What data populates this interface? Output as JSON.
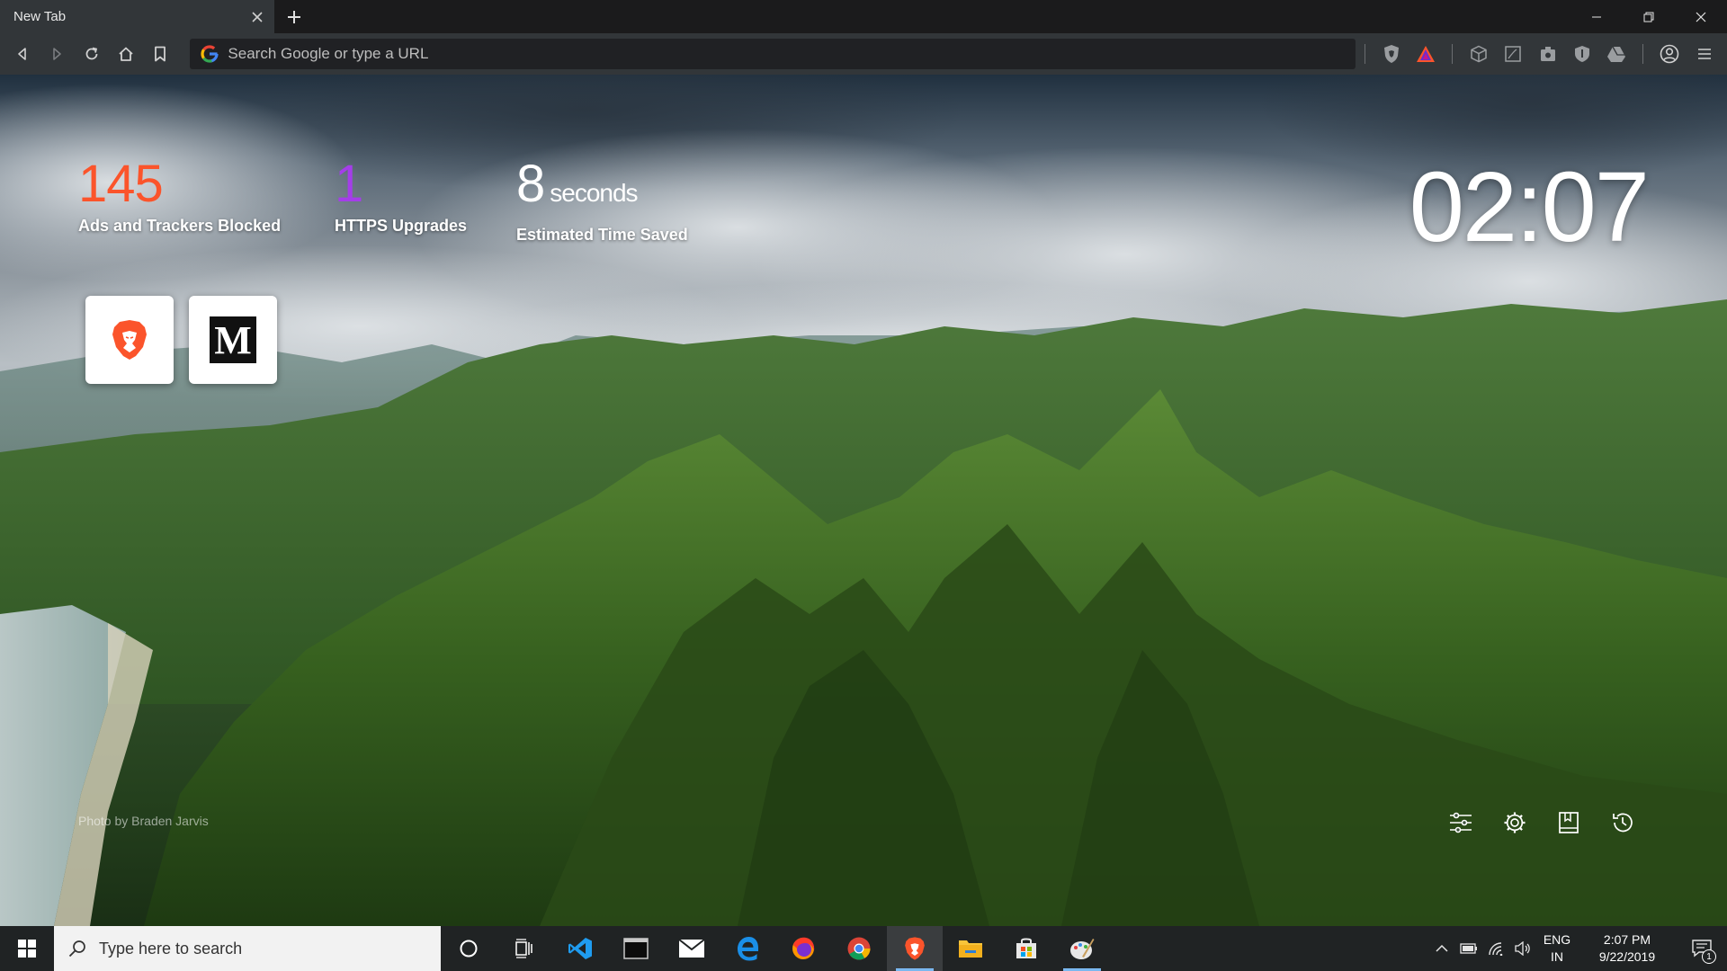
{
  "tab": {
    "title": "New Tab"
  },
  "omnibox": {
    "placeholder": "Search Google or type a URL"
  },
  "stats": {
    "ads": {
      "value": "145",
      "label": "Ads and Trackers Blocked"
    },
    "https": {
      "value": "1",
      "label": "HTTPS Upgrades"
    },
    "time": {
      "value": "8",
      "unit": "seconds",
      "label": "Estimated Time Saved"
    }
  },
  "clock": {
    "time": "02:07"
  },
  "top_sites": [
    {
      "name": "Brave",
      "icon": "brave-lion-icon"
    },
    {
      "name": "Medium",
      "letter": "M"
    }
  ],
  "photo_credit": "Photo by Braden Jarvis",
  "taskbar": {
    "search_placeholder": "Type here to search",
    "apps": [
      "cortana-icon",
      "task-view-icon",
      "vscode-icon",
      "terminal-icon",
      "mail-icon",
      "edge-icon",
      "firefox-icon",
      "chrome-icon",
      "brave-icon",
      "file-explorer-icon",
      "store-icon",
      "paint-icon"
    ],
    "lang_line1": "ENG",
    "lang_line2": "IN",
    "time": "2:07 PM",
    "date": "9/22/2019",
    "notifications": "1"
  },
  "colors": {
    "ads": "#fb542b",
    "https": "#a43ee9",
    "tab_strip": "#1b1b1c",
    "toolbar": "#323639",
    "taskbar": "#202324"
  }
}
